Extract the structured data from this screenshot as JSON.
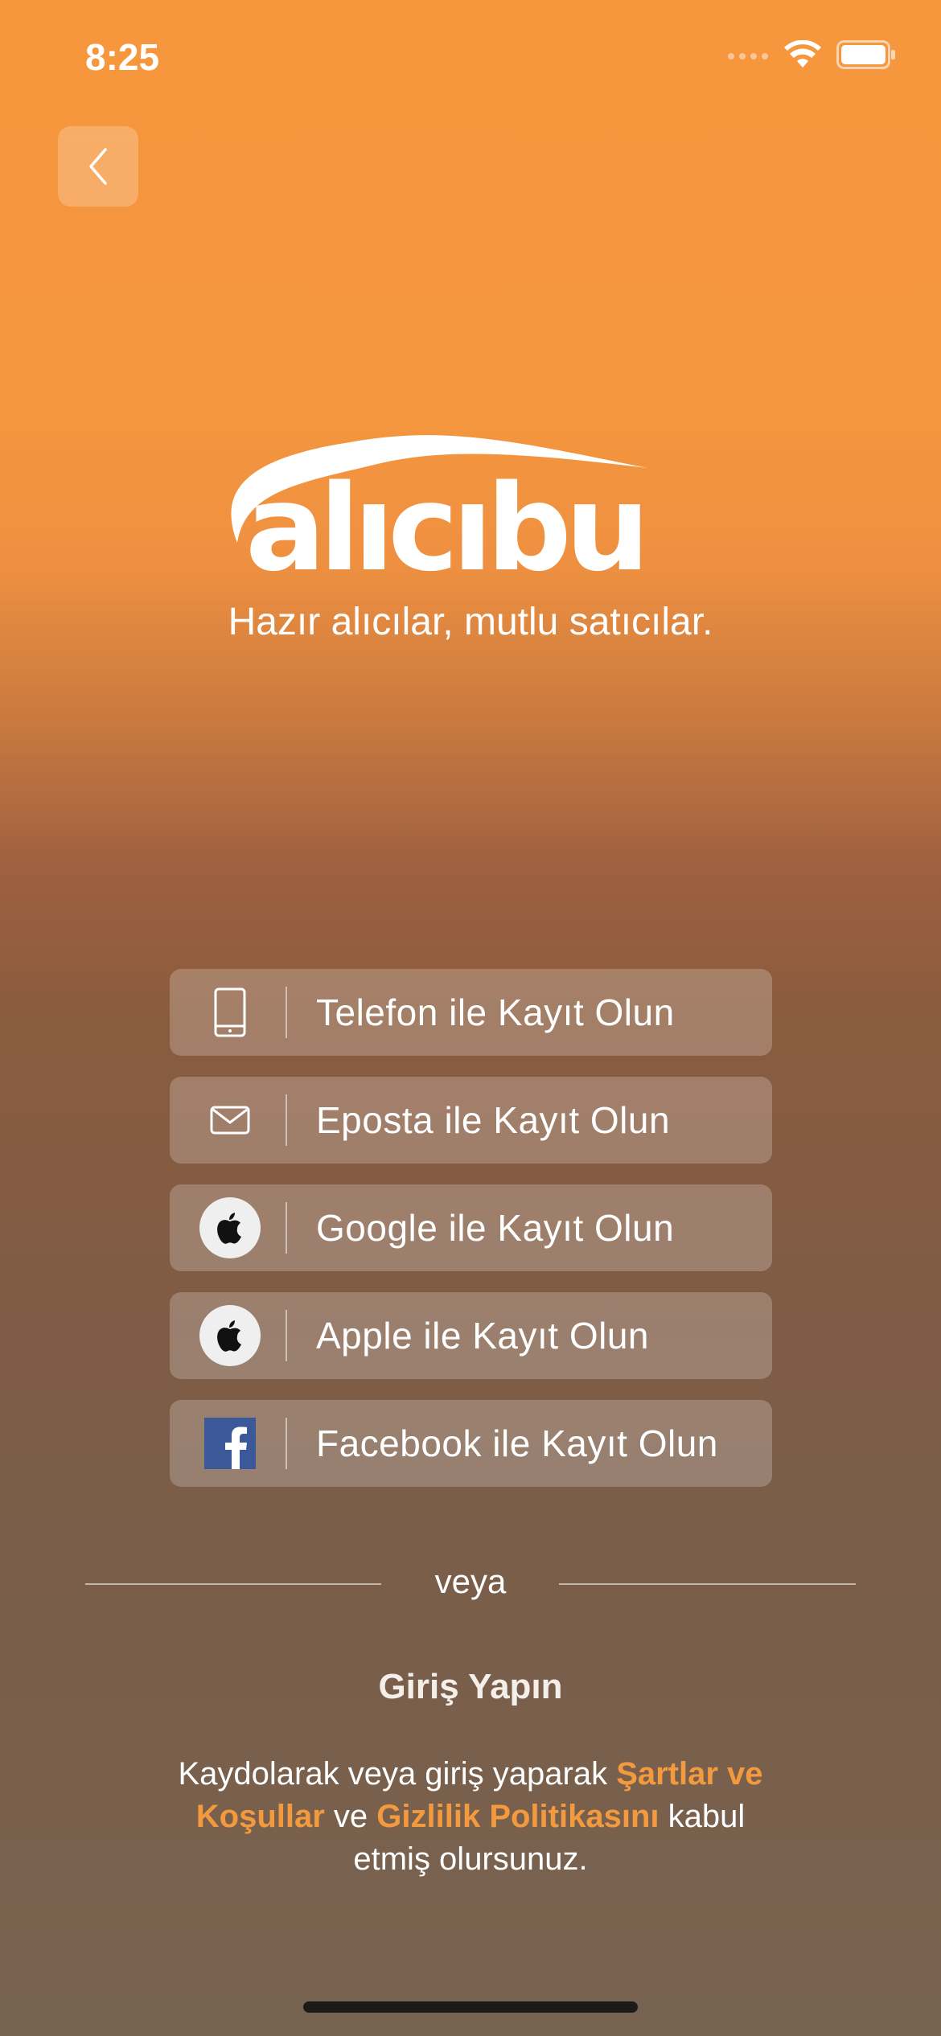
{
  "status_bar": {
    "time": "8:25"
  },
  "brand": {
    "logo_text": "alıcıbul",
    "tagline": "Hazır alıcılar, mutlu satıcılar."
  },
  "signup": {
    "phone_label": "Telefon ile Kayıt Olun",
    "email_label": "Eposta ile Kayıt Olun",
    "google_label": "Google ile Kayıt Olun",
    "apple_label": "Apple ile Kayıt Olun",
    "facebook_label": "Facebook ile Kayıt Olun"
  },
  "divider_text": "veya",
  "login_label": "Giriş Yapın",
  "terms": {
    "prefix": "Kaydolarak veya giriş yaparak ",
    "terms_link": "Şartlar ve Koşullar",
    "middle": " ve ",
    "privacy_link": "Gizlilik Politikasını",
    "suffix": " kabul etmiş olursunuz."
  },
  "colors": {
    "accent": "#F49A3E",
    "background_top": "#F6963D",
    "background_bottom": "#786350"
  },
  "icons": [
    "chevron-left-icon",
    "phone-icon",
    "mail-icon",
    "apple-icon",
    "facebook-icon",
    "wifi-icon",
    "battery-icon",
    "signal-icon"
  ]
}
